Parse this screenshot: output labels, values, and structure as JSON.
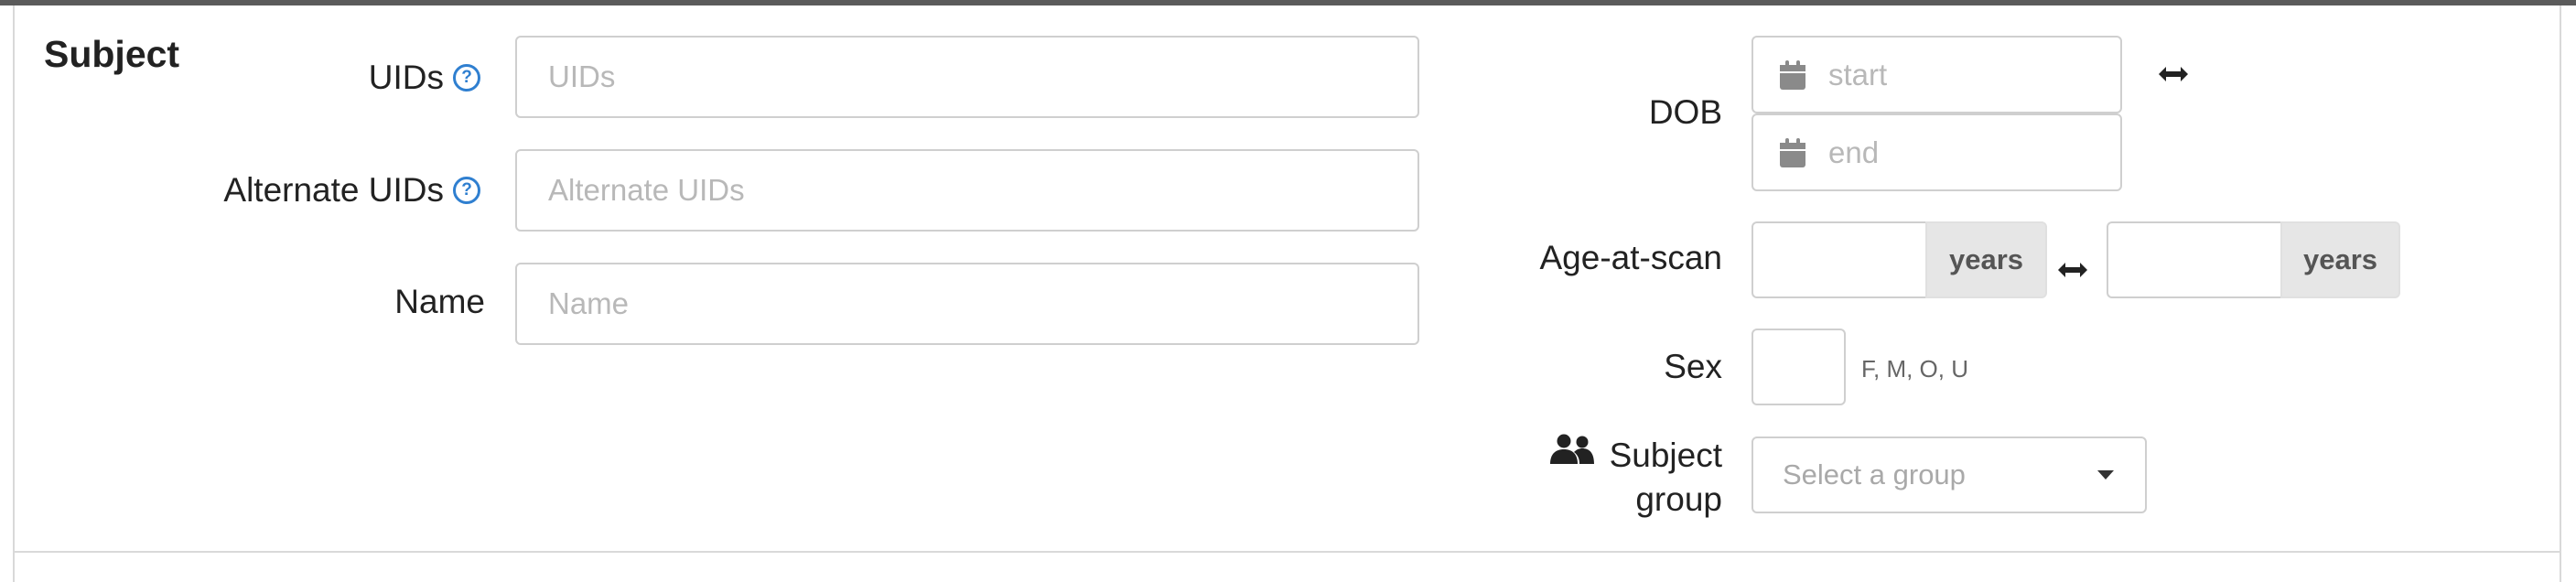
{
  "section": {
    "title": "Subject"
  },
  "fields": {
    "uids": {
      "label": "UIDs",
      "placeholder": "UIDs",
      "help_icon": "question-circle-icon"
    },
    "alternate_uids": {
      "label": "Alternate UIDs",
      "placeholder": "Alternate UIDs",
      "help_icon": "question-circle-icon"
    },
    "name": {
      "label": "Name",
      "placeholder": "Name"
    },
    "dob": {
      "label": "DOB",
      "start_placeholder": "start",
      "end_placeholder": "end",
      "icon": "calendar-icon",
      "range_icon": "left-right-arrow-icon"
    },
    "age_at_scan": {
      "label": "Age-at-scan",
      "unit_min": "years",
      "unit_max": "years",
      "range_icon": "left-right-arrow-icon"
    },
    "sex": {
      "label": "Sex",
      "hint": "F, M, O, U"
    },
    "subject_group": {
      "label_line1": "Subject",
      "label_line2": "group",
      "icon": "users-icon",
      "placeholder": "Select a group"
    }
  },
  "colors": {
    "help": "#2f7fd0",
    "topbar": "#5b5b5b",
    "border": "#cfcfcf",
    "addon_bg": "#e6e6e6"
  }
}
